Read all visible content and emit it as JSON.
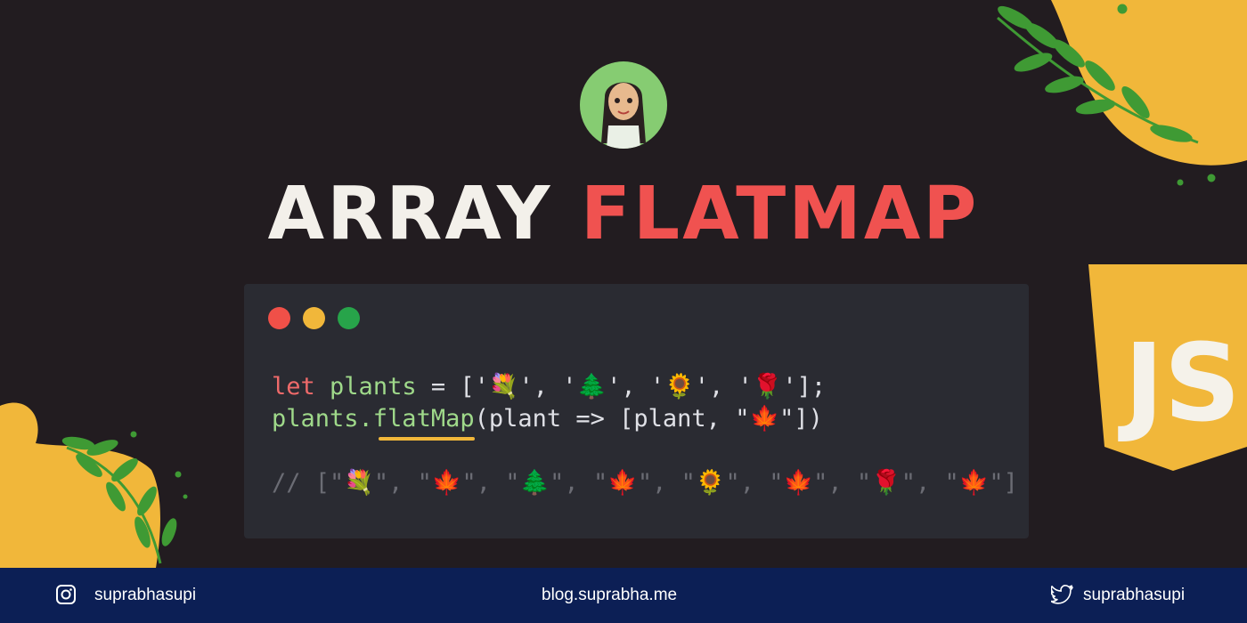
{
  "title": {
    "word1": "ARRAY",
    "word2": "FLATMAP"
  },
  "code": {
    "line1": {
      "keyword": "let",
      "ident": "plants",
      "rest": " = ['💐', '🌲', '🌻', '🌹'];"
    },
    "line2": {
      "obj": "plants.",
      "method": "flatMap",
      "rest": "(plant => [plant, \"🍁\"])"
    },
    "comment": "// [\"💐\", \"🍁\", \"🌲\", \"🍁\", \"🌻\", \"🍁\", \"🌹\", \"🍁\"]"
  },
  "footer": {
    "instagram": "suprabhasupi",
    "blog": "blog.suprabha.me",
    "twitter": "suprabhasupi"
  },
  "icons": [
    "instagram-icon",
    "twitter-icon",
    "js-logo-icon",
    "avatar",
    "leaf-branch-icon"
  ],
  "colors": {
    "accent_red": "#f05250",
    "accent_yellow": "#f1b73a",
    "footer_bg": "#0c1f55",
    "bg": "#221c20"
  }
}
